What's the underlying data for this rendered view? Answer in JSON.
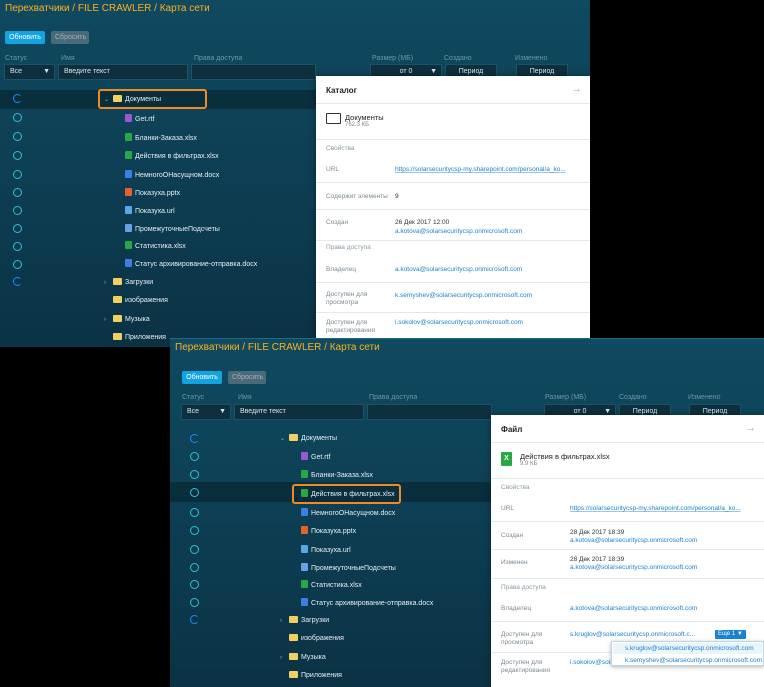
{
  "panel1": {
    "breadcrumb": "Перехватчики / FILE CRAWLER / Карта сети",
    "refresh": "Обновить",
    "reset": "Сбросить",
    "columns": [
      "Статус",
      "Имя",
      "Права доступа",
      "Размер (МБ)",
      "Создано",
      "Изменено"
    ],
    "filters": {
      "status": "Все",
      "name_placeholder": "Введите текст",
      "size_from": "от 0",
      "created": "Период",
      "modified": "Период"
    },
    "tree": [
      {
        "name": "Документы",
        "type": "folder",
        "open": true
      },
      {
        "name": "Get.rtf",
        "type": "rtf"
      },
      {
        "name": "Бланки-Заказа.xlsx",
        "type": "xls"
      },
      {
        "name": "Действия в фильтрах.xlsx",
        "type": "xls"
      },
      {
        "name": "НемногоОНасущном.docx",
        "type": "doc"
      },
      {
        "name": "Показуха.pptx",
        "type": "ppt"
      },
      {
        "name": "Показуха.url",
        "type": "url"
      },
      {
        "name": "ПромежуточныеПодсчеты",
        "type": "txt"
      },
      {
        "name": "Статистика.xlsx",
        "type": "xls"
      },
      {
        "name": "Статус архивирование-отправка.docx",
        "type": "doc"
      },
      {
        "name": "Загрузки",
        "type": "folder"
      },
      {
        "name": "изображения",
        "type": "folder"
      },
      {
        "name": "Музыка",
        "type": "folder"
      },
      {
        "name": "Приложения",
        "type": "folder"
      }
    ],
    "card": {
      "title": "Каталог",
      "item_name": "Документы",
      "item_size": "762.3 КБ",
      "section_props": "Свойства",
      "url_label": "URL",
      "url_value": "https://solarsecuritycsp-my.sharepoint.com/personal/a_ko...",
      "count_label": "Содержит элементы",
      "count_value": "9",
      "created_label": "Создан",
      "created_date": "26 Дек 2017 12:00",
      "created_by": "a.kotova@solarsecuritycsp.onmicrosoft.com",
      "section_access": "Права доступа",
      "owner_label": "Владелец",
      "owner_value": "a.kotova@solarsecuritycsp.onmicrosoft.com",
      "view_label": "Доступен для просмотра",
      "view_value": "k.semyshev@solarsecuritycsp.onmicrosoft.com",
      "edit_label": "Доступен для редактирования",
      "edit_value": "i.sokolov@solarsecuritycsp.onmicrosoft.com"
    }
  },
  "panel2": {
    "breadcrumb": "Перехватчики / FILE CRAWLER / Карта сети",
    "refresh": "Обновить",
    "reset": "Сбросить",
    "columns": [
      "Статус",
      "Имя",
      "Права доступа",
      "Размер (МБ)",
      "Создано",
      "Изменено"
    ],
    "filters": {
      "status": "Все",
      "name_placeholder": "Введите текст",
      "size_from": "от 0",
      "created": "Период",
      "modified": "Период"
    },
    "card": {
      "title": "Файл",
      "item_name": "Действия в фильтрах.xlsx",
      "item_size": "9.9 КБ",
      "section_props": "Свойства",
      "url_label": "URL",
      "url_value": "https://solarsecuritycsp-my.sharepoint.com/personal/a_ko...",
      "created_label": "Создан",
      "created_date": "28 Дек 2017 18:39",
      "created_by": "a.kotova@solarsecuritycsp.onmicrosoft.com",
      "modified_label": "Изменен",
      "modified_date": "28 Дек 2017 18:39",
      "modified_by": "a.kotova@solarsecuritycsp.onmicrosoft.com",
      "section_access": "Права доступа",
      "owner_label": "Владелец",
      "owner_value": "a.kotova@solarsecuritycsp.onmicrosoft.com",
      "view_label": "Доступен для просмотра",
      "view_value": "s.kruglov@solarsecuritycsp.onmicrosoft.c...",
      "more_label": "Еще 1",
      "edit_label": "Доступен для редактирования",
      "edit_value": "i.sokolov@solarsecuritycsp.onmicrosoft.c...",
      "dropdown": [
        "s.kruglov@solarsecuritycsp.onmicrosoft.com",
        "k.semyshev@solarsecuritycsp.onmicrosoft.com"
      ]
    }
  },
  "colors": {
    "accent": "#12a3e0",
    "highlight": "#f08a24",
    "breadcrumb": "#ffb020"
  }
}
